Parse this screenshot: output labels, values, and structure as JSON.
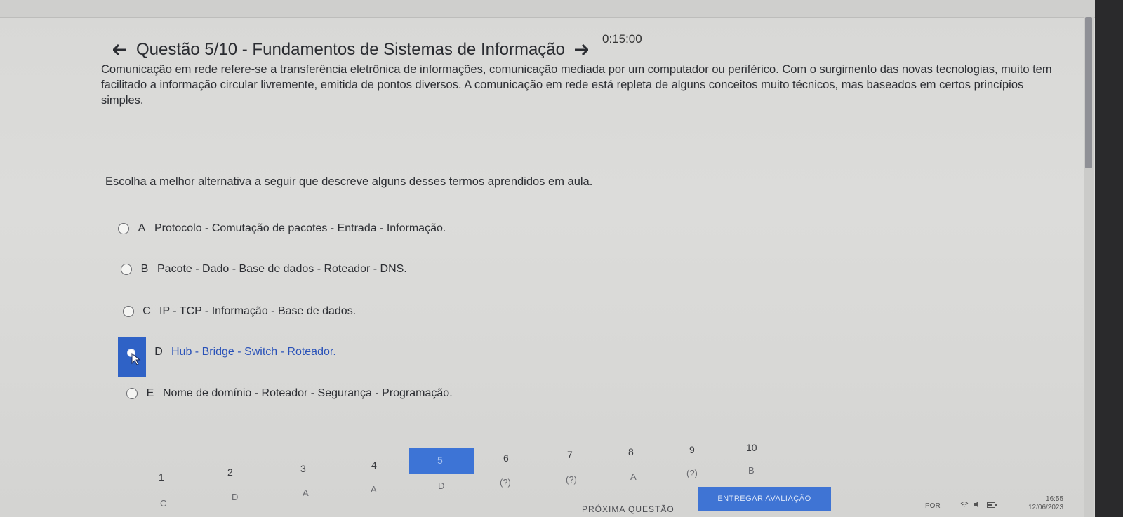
{
  "header": {
    "timer": "0:15:00",
    "title": "Questão 5/10 - Fundamentos de Sistemas de Informação"
  },
  "question": {
    "statement": "Comunicação em rede refere-se a transferência eletrônica de informações, comunicação mediada por um computador ou periférico. Com o surgimento das novas tecnologias, muito tem facilitado a informação circular livremente, emitida de pontos diversos. A comunicação em rede está repleta de alguns conceitos muito técnicos, mas baseados em certos princípios simples.",
    "prompt": "Escolha a melhor alternativa a seguir que descreve alguns desses termos aprendidos em aula.",
    "options": [
      {
        "letter": "A",
        "text": "Protocolo - Comutação de pacotes - Entrada - Informação."
      },
      {
        "letter": "B",
        "text": "Pacote - Dado - Base de dados - Roteador - DNS."
      },
      {
        "letter": "C",
        "text": "IP - TCP - Informação - Base de dados."
      },
      {
        "letter": "D",
        "text": "Hub - Bridge - Switch - Roteador."
      },
      {
        "letter": "E",
        "text": "Nome de domínio - Roteador - Segurança - Programação."
      }
    ],
    "selected": "D"
  },
  "navigator": {
    "numbers": [
      "1",
      "2",
      "3",
      "4",
      "5",
      "6",
      "7",
      "8",
      "9",
      "10"
    ],
    "answers": [
      "C",
      "D",
      "A",
      "A",
      "D",
      "(?)",
      "(?)",
      "A",
      "(?)",
      "B"
    ],
    "current": "5"
  },
  "footer": {
    "next_label": "PRÓXIMA QUESTÃO",
    "submit_label": "ENTREGAR AVALIAÇÃO"
  },
  "taskbar": {
    "lang": "POR",
    "time": "16:55",
    "date": "12/06/2023"
  },
  "colors": {
    "accent": "#3d74d6",
    "selected_text": "#2a52b8"
  }
}
